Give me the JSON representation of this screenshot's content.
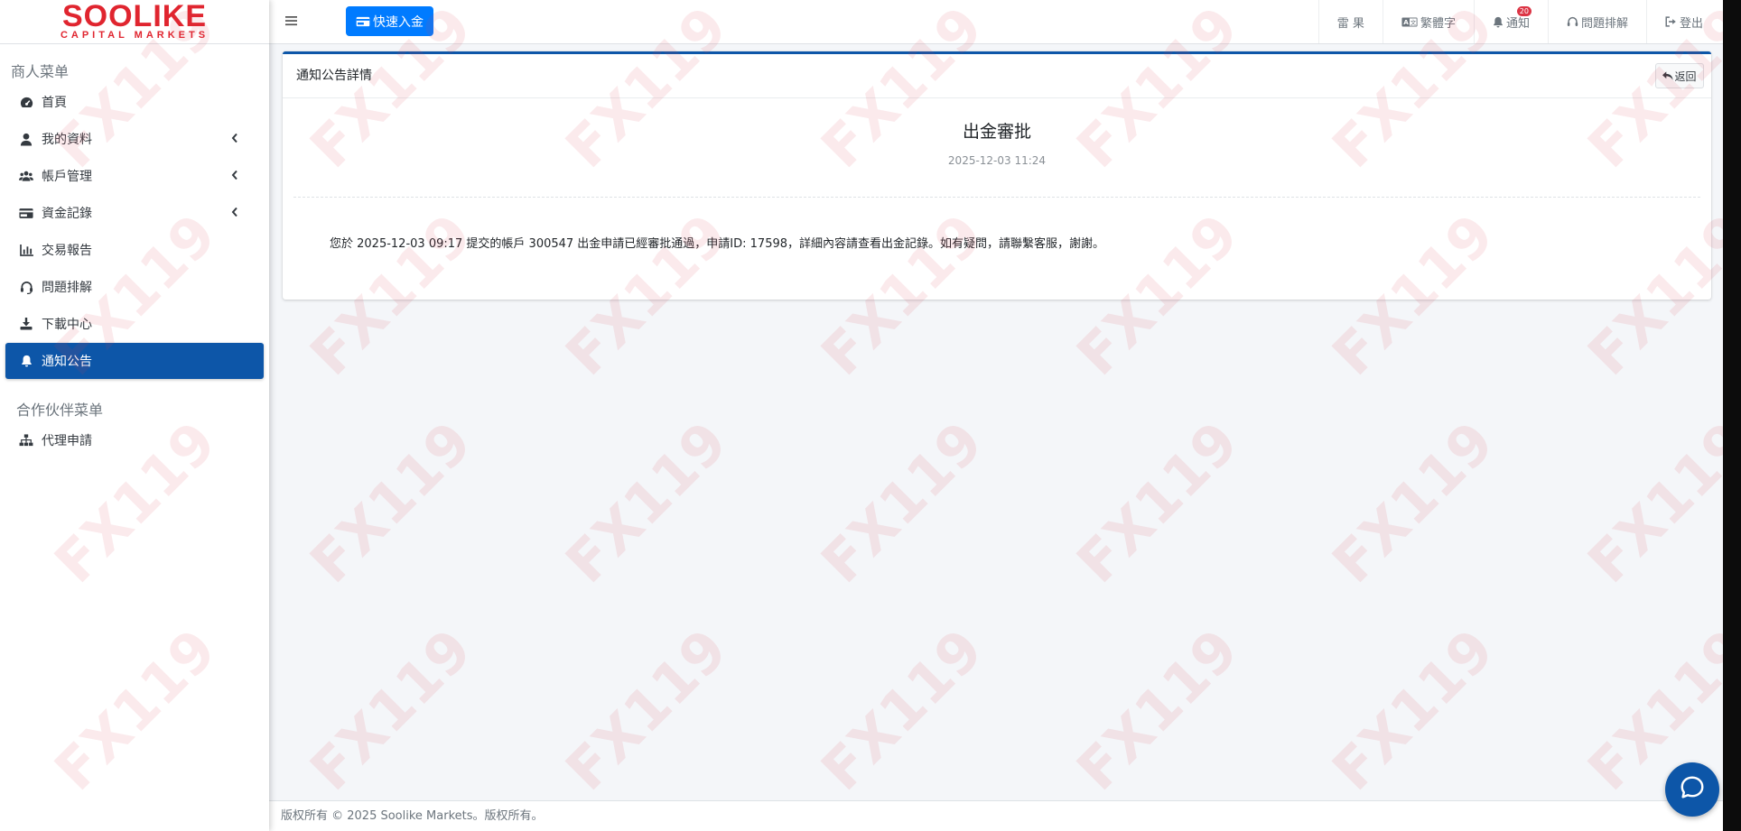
{
  "brand": {
    "name": "SOOLIKE",
    "tagline": "CAPITAL MARKETS"
  },
  "sidebar": {
    "merchant_header": "商人菜单",
    "items": [
      {
        "label": "首頁",
        "icon": "dashboard-icon"
      },
      {
        "label": "我的資料",
        "icon": "user-icon",
        "expandable": true
      },
      {
        "label": "帳戶管理",
        "icon": "users-icon",
        "expandable": true
      },
      {
        "label": "資金記錄",
        "icon": "credit-card-icon",
        "expandable": true
      },
      {
        "label": "交易報告",
        "icon": "chart-bar-icon"
      },
      {
        "label": "問題排解",
        "icon": "headset-icon"
      },
      {
        "label": "下載中心",
        "icon": "download-icon"
      },
      {
        "label": "通知公告",
        "icon": "bell-icon",
        "active": true
      }
    ],
    "partner_header": "合作伙伴菜单",
    "partner_items": [
      {
        "label": "代理申請",
        "icon": "sitemap-icon"
      }
    ]
  },
  "topbar": {
    "quick_deposit_label": "快速入金",
    "nav": {
      "theme_label": "雷 果",
      "language_label": "繁體字",
      "notifications_label": "通知",
      "notifications_count": "20",
      "support_label": "問題排解",
      "logout_label": "登出"
    }
  },
  "card": {
    "header_title": "通知公告詳情",
    "back_label": "返回",
    "notice_title": "出金審批",
    "notice_time": "2025-12-03 11:24",
    "notice_body": "您於 2025-12-03 09:17 提交的帳戶 300547 出金申請已經審批通過，申請ID: 17598，詳細內容請查看出金記錄。如有疑問，請聯繫客服，謝謝。"
  },
  "footer": {
    "text": "版权所有 © 2025 Soolike Markets。版权所有。"
  },
  "watermark": {
    "text": "FX119"
  },
  "colors": {
    "primary": "#0d56a8",
    "button": "#007bff",
    "brand_red": "#e0252f",
    "badge": "#dc3545"
  }
}
